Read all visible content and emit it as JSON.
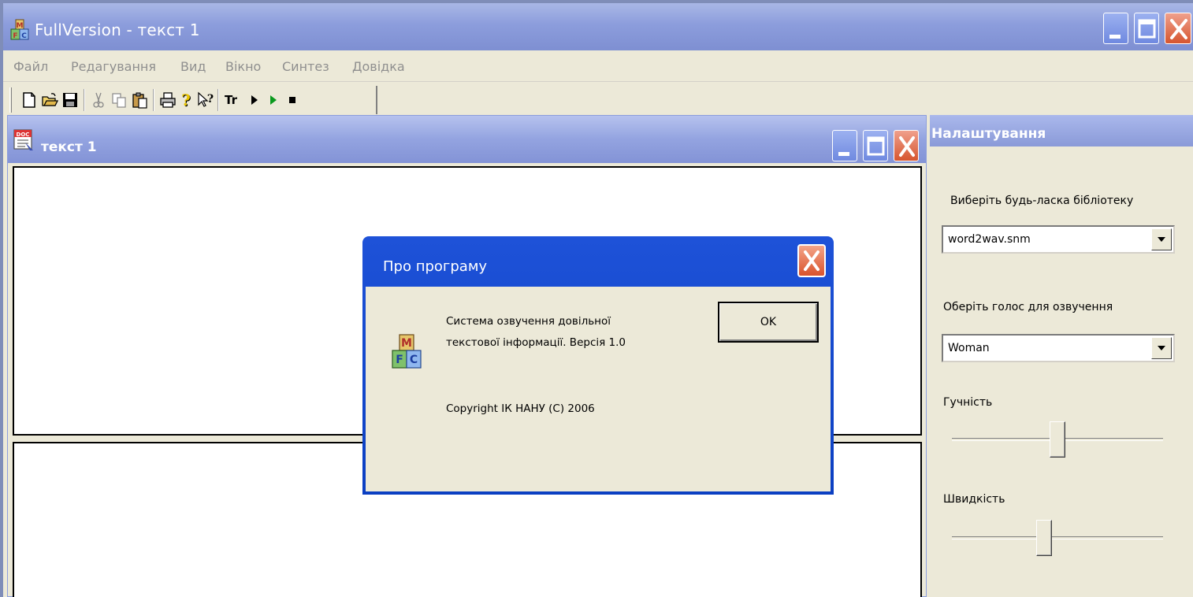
{
  "app": {
    "title": "FullVersion - текст 1",
    "window_buttons": [
      "minimize",
      "maximize",
      "close"
    ]
  },
  "menu": {
    "items": [
      "Файл",
      "Редагування",
      "Вид",
      "Вікно",
      "Синтез",
      "Довідка"
    ]
  },
  "toolbar": {
    "buttons": [
      {
        "icon": "new-document-icon"
      },
      {
        "icon": "open-folder-icon"
      },
      {
        "icon": "save-icon"
      },
      {
        "icon": "cut-icon"
      },
      {
        "icon": "copy-icon"
      },
      {
        "icon": "paste-icon"
      },
      {
        "icon": "print-icon"
      },
      {
        "icon": "help-icon"
      },
      {
        "icon": "context-help-icon"
      },
      {
        "icon": "transcription-icon",
        "label": "Tr"
      },
      {
        "icon": "play-icon"
      },
      {
        "icon": "play-green-icon"
      },
      {
        "icon": "stop-icon"
      }
    ]
  },
  "child": {
    "title": "текст 1"
  },
  "settings": {
    "title": "Налаштування",
    "library_label": "Виберіть будь-ласка бібліотеку",
    "library_value": "word2wav.snm",
    "voice_label": "Оберіть голос для озвучення",
    "voice_value": "Woman",
    "volume_label": "Гучність",
    "volume_level": 0.5,
    "speed_label": "Швидкість",
    "speed_level": 0.43
  },
  "about": {
    "title": "Про програму",
    "line1": "Система озвучення довільної",
    "line2": "текстової інформації. Версія 1.0",
    "copyright": "Copyright ІК НАНУ (С) 2006",
    "ok_label": "OK"
  },
  "colors": {
    "titlebar": "#8c9ddc",
    "dialog_titlebar": "#0b3fc2",
    "close_red": "#d6552f",
    "face": "#ece9d8"
  }
}
